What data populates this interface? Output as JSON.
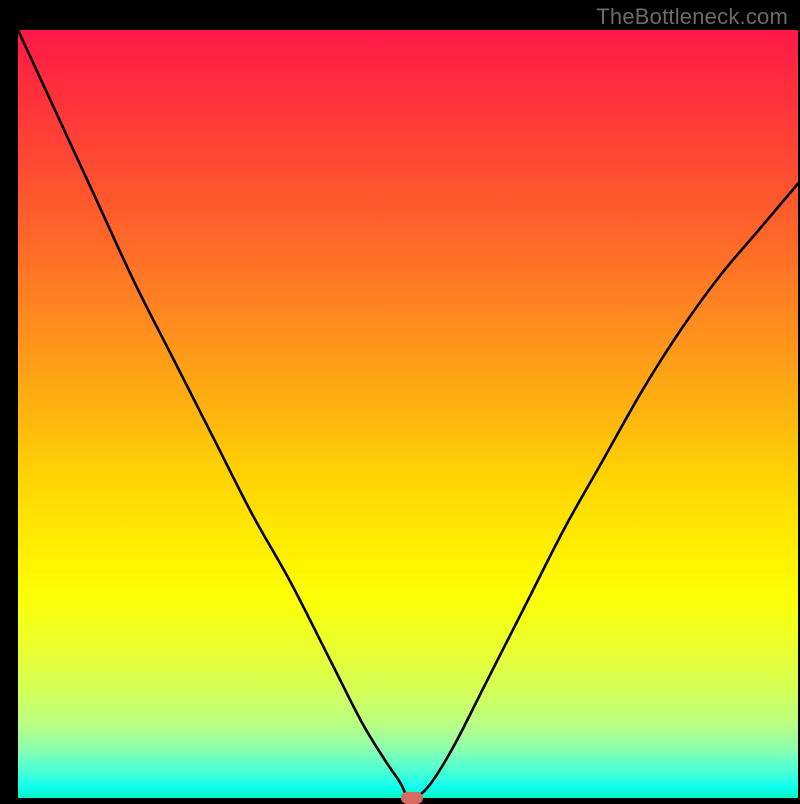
{
  "watermark": "TheBottleneck.com",
  "chart_data": {
    "type": "line",
    "title": "",
    "xlabel": "",
    "ylabel": "",
    "xlim": [
      0,
      100
    ],
    "ylim": [
      0,
      100
    ],
    "grid": false,
    "legend": false,
    "series": [
      {
        "name": "bottleneck-curve",
        "x": [
          0,
          5,
          10,
          15,
          20,
          25,
          30,
          35,
          40,
          44,
          47,
          49,
          50,
          51,
          53,
          56,
          60,
          65,
          70,
          75,
          80,
          85,
          90,
          95,
          100
        ],
        "y": [
          100,
          89,
          78,
          67,
          57,
          47,
          37,
          28,
          18,
          10,
          5,
          2,
          0,
          0,
          2,
          7,
          15,
          25,
          35,
          44,
          53,
          61,
          68,
          74,
          80
        ]
      }
    ],
    "marker": {
      "x": 50.5,
      "y": 0,
      "color": "#d86a62"
    },
    "background_gradient": {
      "direction": "vertical",
      "stops": [
        {
          "pos": 0.0,
          "color": "#ff1848"
        },
        {
          "pos": 0.5,
          "color": "#ffc400"
        },
        {
          "pos": 0.72,
          "color": "#fff500"
        },
        {
          "pos": 0.9,
          "color": "#bcff7e"
        },
        {
          "pos": 1.0,
          "color": "#00f6c6"
        }
      ]
    }
  }
}
